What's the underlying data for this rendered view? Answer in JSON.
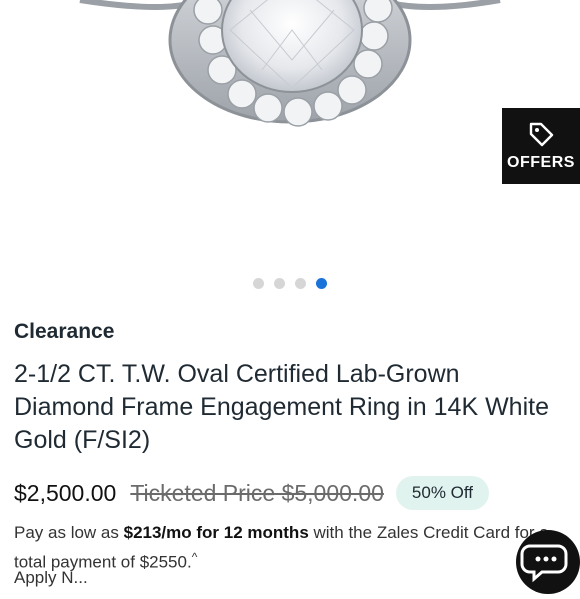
{
  "gallery": {
    "slides_total": 4,
    "active_slide": 4
  },
  "offers": {
    "label": "OFFERS",
    "icon": "tag-icon"
  },
  "product": {
    "category": "Clearance",
    "title": "2-1/2 CT. T.W. Oval Certified Lab-Grown Diamond Frame Engagement Ring in 14K White Gold (F/SI2)",
    "price": "$2,500.00",
    "ticketed_price": "Ticketed Price $5,000.00",
    "discount_badge": "50% Off"
  },
  "financing": {
    "prefix": "Pay as low as ",
    "monthly": "$213/mo for 12 months",
    "middle": " with the Zales Credit Card for a total payment of ",
    "total": "$2550.",
    "caret": "^",
    "apply_partial": "Apply N..."
  },
  "chat": {
    "icon": "chat-icon"
  },
  "colors": {
    "accent_dot": "#1a73d9",
    "badge_bg": "#e1f3ef",
    "offers_bg": "#111111"
  }
}
